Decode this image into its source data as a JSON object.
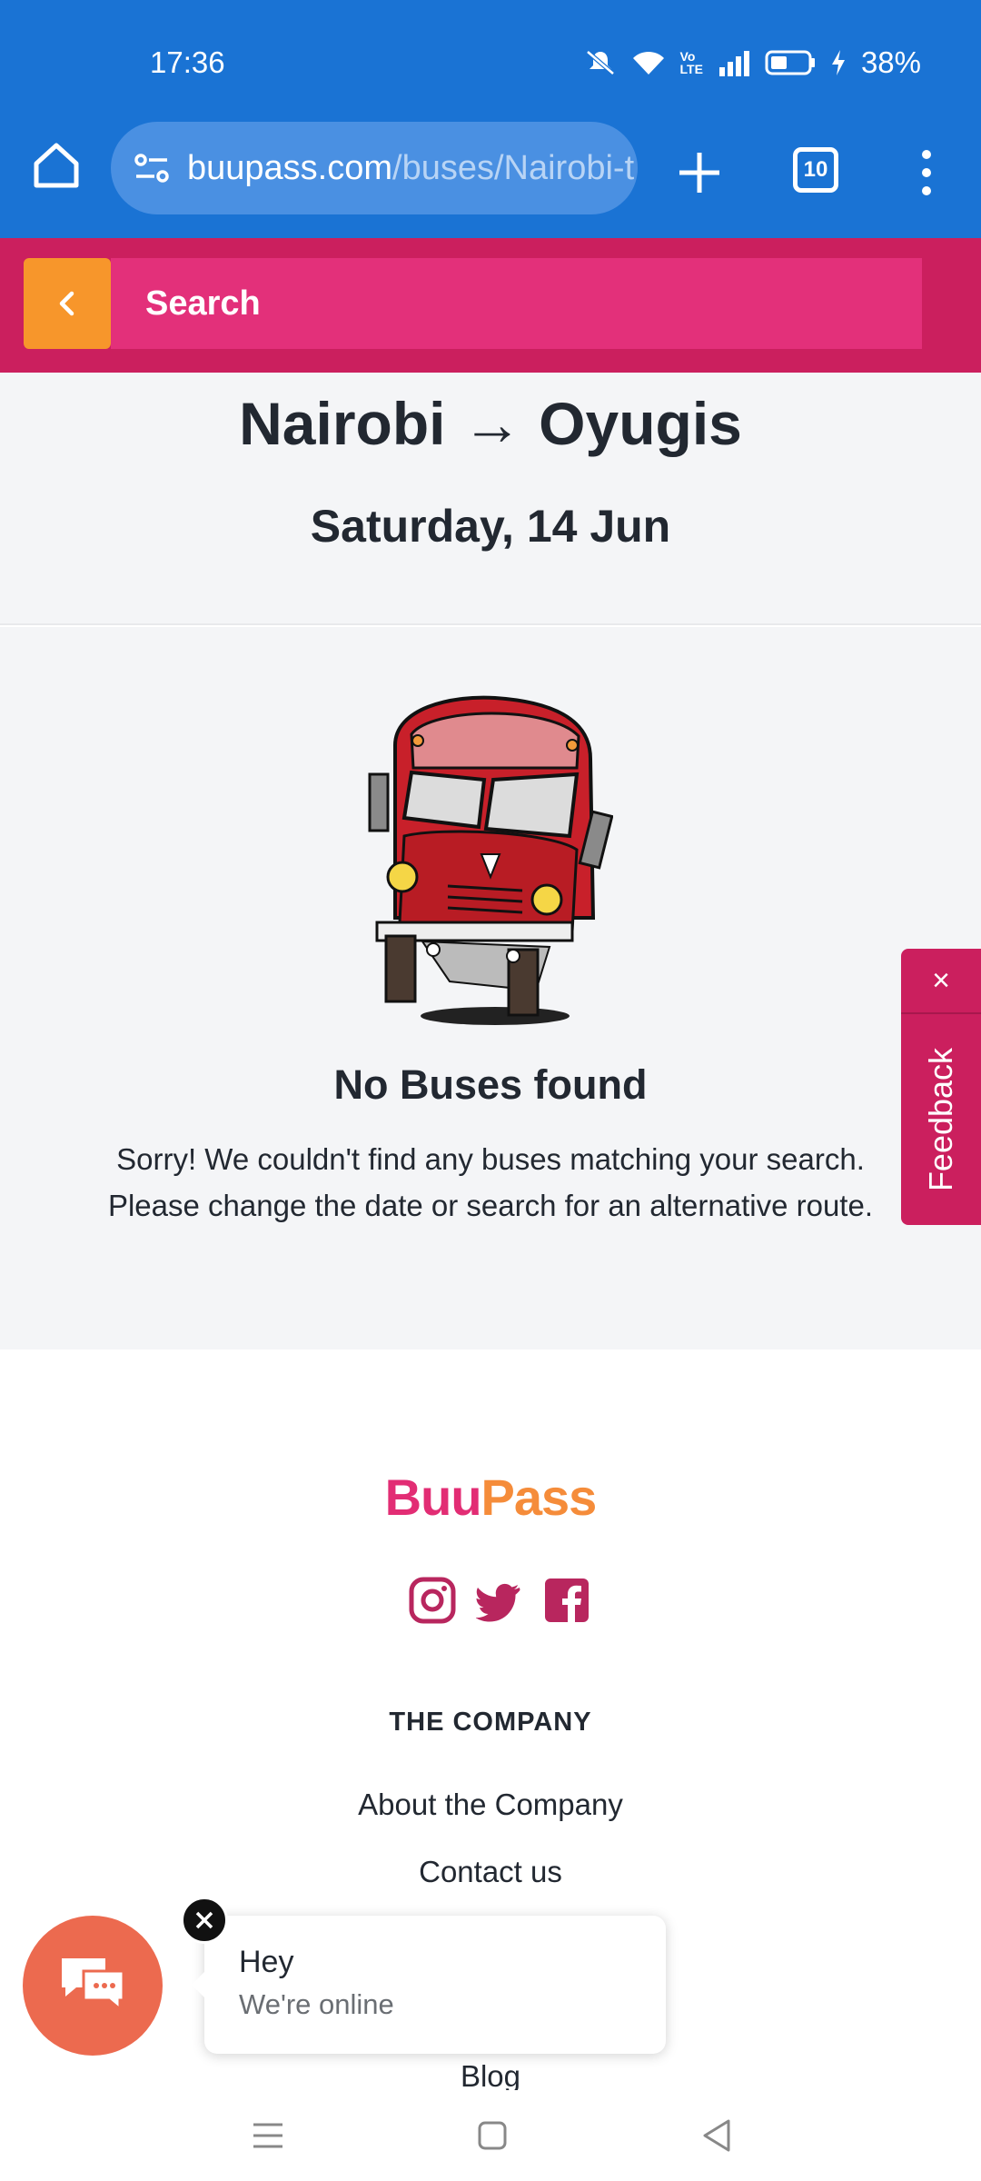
{
  "status_bar": {
    "time": "17:36",
    "battery": "38%"
  },
  "browser": {
    "url_domain": "buupass.com",
    "url_path": "/buses/Nairobi-t",
    "tab_count": "10"
  },
  "search_bar": {
    "label": "Search"
  },
  "route": {
    "origin": "Nairobi",
    "arrow": "→",
    "destination": "Oyugis",
    "date": "Saturday, 14 Jun"
  },
  "empty_state": {
    "title": "No Buses found",
    "line1": "Sorry! We couldn't find any buses matching your search.",
    "line2": "Please change the date or search for an alternative route."
  },
  "feedback": {
    "label": "Feedback",
    "close": "×"
  },
  "footer": {
    "logo_part1": "Buu",
    "logo_part2": "Pass",
    "heading": "THE COMPANY",
    "links": [
      "About the Company",
      "Contact us",
      "Blog"
    ]
  },
  "chat": {
    "greeting": "Hey",
    "status": "We're online"
  },
  "icons": {
    "home": "home-icon",
    "site_info": "site-settings-icon",
    "new_tab": "plus-icon",
    "menu": "more-vert-icon",
    "back": "chevron-left-icon",
    "instagram": "instagram-icon",
    "twitter": "twitter-icon",
    "facebook": "facebook-icon",
    "chat": "chat-icon"
  },
  "colors": {
    "browser_blue": "#1a73d4",
    "brand_pink": "#cb1f5e",
    "brand_orange": "#f7962b",
    "chat_orange": "#ec6a4f"
  }
}
